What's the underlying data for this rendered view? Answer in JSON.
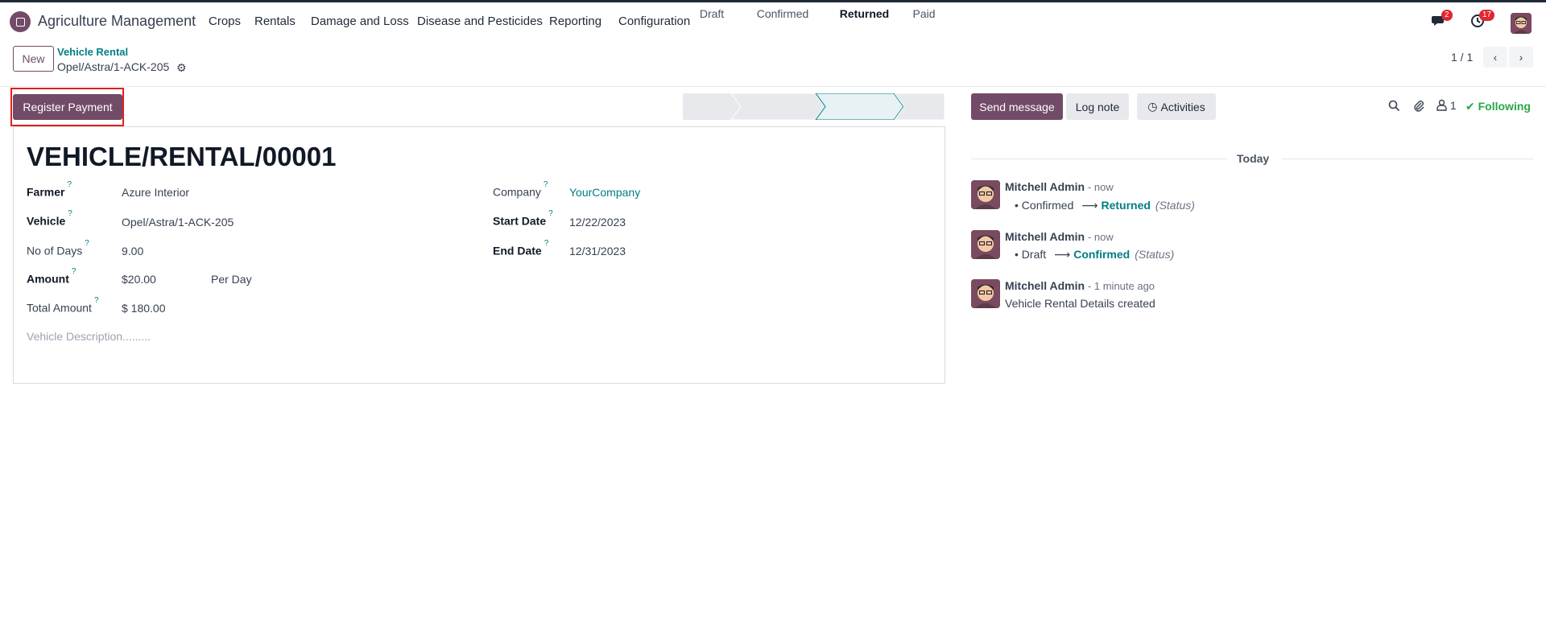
{
  "navbar": {
    "app_name": "Agriculture Management",
    "menu": [
      "Crops",
      "Rentals",
      "Damage and Loss",
      "Disease and Pesticides",
      "Reporting",
      "Configuration"
    ],
    "messages_count": "2",
    "activities_count": "17"
  },
  "control": {
    "new_label": "New",
    "breadcrumb_parent": "Vehicle Rental",
    "breadcrumb_current": "Opel/Astra/1-ACK-205",
    "pager": "1 / 1"
  },
  "statusbar": {
    "register_payment": "Register Payment",
    "stages": [
      "Draft",
      "Confirmed",
      "Returned",
      "Paid"
    ],
    "active_stage": "Returned"
  },
  "form": {
    "title": "VEHICLE/RENTAL/00001",
    "farmer_label": "Farmer",
    "farmer_value": "Azure Interior",
    "vehicle_label": "Vehicle",
    "vehicle_value": "Opel/Astra/1-ACK-205",
    "days_label": "No of Days",
    "days_value": "9.00",
    "amount_label": "Amount",
    "amount_value": "$20.00",
    "amount_unit": "Per Day",
    "total_label": "Total Amount",
    "total_value": "$ 180.00",
    "description_placeholder": "Vehicle Description.........",
    "company_label": "Company",
    "company_value": "YourCompany",
    "start_label": "Start Date",
    "start_value": "12/22/2023",
    "end_label": "End Date",
    "end_value": "12/31/2023",
    "help_mark": "?"
  },
  "chatter": {
    "send_message": "Send message",
    "log_note": "Log note",
    "activities": "Activities",
    "followers_count": "1",
    "following": "Following",
    "today": "Today",
    "messages": [
      {
        "author": "Mitchell Admin",
        "time": "- now",
        "old": "Confirmed",
        "new": "Returned",
        "field": "(Status)"
      },
      {
        "author": "Mitchell Admin",
        "time": "- now",
        "old": "Draft",
        "new": "Confirmed",
        "field": "(Status)"
      },
      {
        "author": "Mitchell Admin",
        "time": "- 1 minute ago",
        "text": "Vehicle Rental Details created"
      }
    ]
  },
  "colors": {
    "brand": "#714b67",
    "link": "#017e84",
    "success": "#28a745",
    "badge": "#e0262f"
  }
}
